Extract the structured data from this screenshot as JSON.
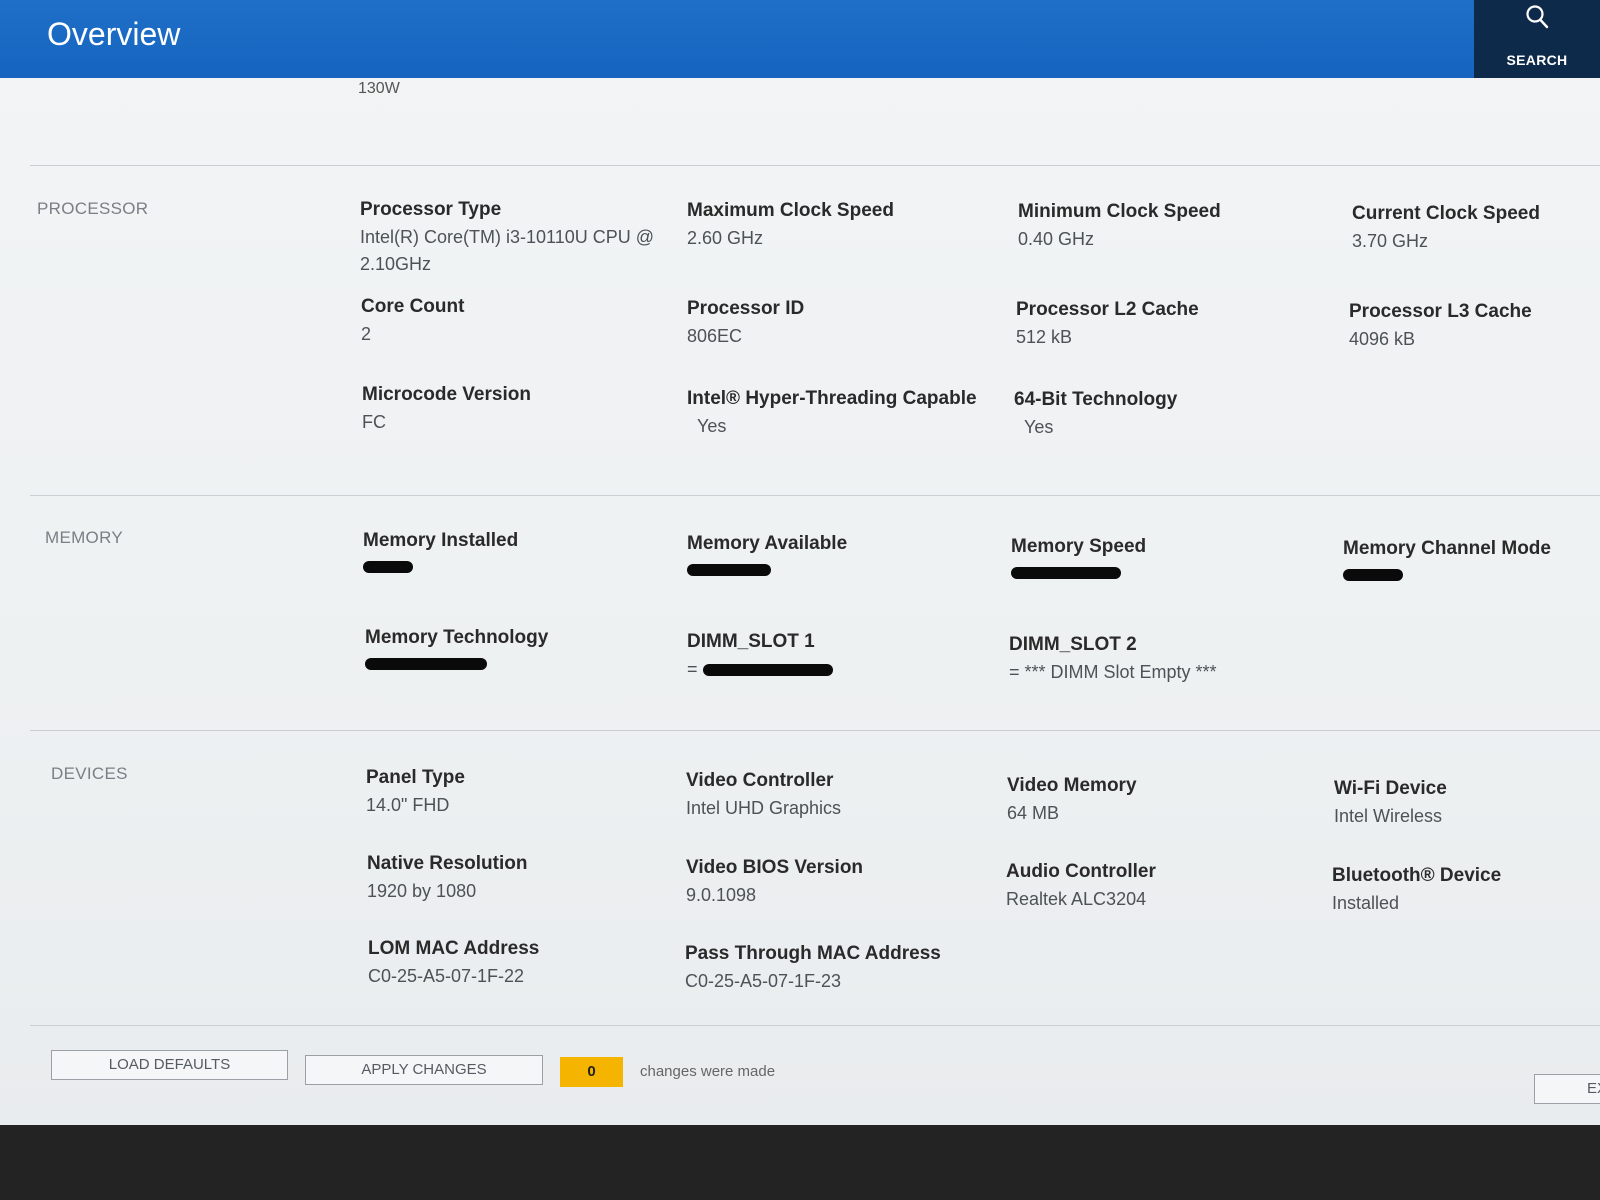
{
  "header": {
    "title": "Overview",
    "search_label": "SEARCH"
  },
  "partial_top_value": "130W",
  "sections": {
    "processor": {
      "label": "PROCESSOR",
      "fields": [
        {
          "label": "Processor Type",
          "value": "Intel(R) Core(TM) i3-10110U CPU @ 2.10GHz"
        },
        {
          "label": "Maximum Clock Speed",
          "value": "2.60 GHz"
        },
        {
          "label": "Minimum Clock Speed",
          "value": "0.40 GHz"
        },
        {
          "label": "Current Clock Speed",
          "value": "3.70 GHz"
        },
        {
          "label": "Core Count",
          "value": "2"
        },
        {
          "label": "Processor ID",
          "value": "806EC"
        },
        {
          "label": "Processor L2 Cache",
          "value": "512 kB"
        },
        {
          "label": "Processor L3 Cache",
          "value": "4096 kB"
        },
        {
          "label": "Microcode Version",
          "value": "FC"
        },
        {
          "label": "Intel® Hyper-Threading Capable",
          "value": "Yes"
        },
        {
          "label": "64-Bit Technology",
          "value": "Yes"
        }
      ]
    },
    "memory": {
      "label": "MEMORY",
      "fields": [
        {
          "label": "Memory Installed",
          "value": ""
        },
        {
          "label": "Memory Available",
          "value": ""
        },
        {
          "label": "Memory Speed",
          "value": ""
        },
        {
          "label": "Memory Channel Mode",
          "value": ""
        },
        {
          "label": "Memory Technology",
          "value": ""
        },
        {
          "label": "DIMM_SLOT 1",
          "value": "="
        },
        {
          "label": "DIMM_SLOT 2",
          "value": "= *** DIMM Slot Empty ***"
        }
      ]
    },
    "devices": {
      "label": "DEVICES",
      "fields": [
        {
          "label": "Panel Type",
          "value": "14.0\" FHD"
        },
        {
          "label": "Video Controller",
          "value": "Intel UHD Graphics"
        },
        {
          "label": "Video Memory",
          "value": "64 MB"
        },
        {
          "label": "Wi-Fi Device",
          "value": "Intel Wireless"
        },
        {
          "label": "Native Resolution",
          "value": "1920 by 1080"
        },
        {
          "label": "Video BIOS Version",
          "value": "9.0.1098"
        },
        {
          "label": "Audio Controller",
          "value": "Realtek ALC3204"
        },
        {
          "label": "Bluetooth® Device",
          "value": "Installed"
        },
        {
          "label": "LOM MAC Address",
          "value": "C0-25-A5-07-1F-22"
        },
        {
          "label": "Pass Through MAC Address",
          "value": "C0-25-A5-07-1F-23"
        }
      ]
    }
  },
  "footer": {
    "load_defaults": "LOAD DEFAULTS",
    "apply_changes": "APPLY CHANGES",
    "changes_count": "0",
    "changes_text": "changes were made",
    "exit_label": "EX"
  },
  "colors": {
    "header": "#1565c0",
    "search_bg": "#0d2a4a",
    "badge": "#f5b400"
  }
}
